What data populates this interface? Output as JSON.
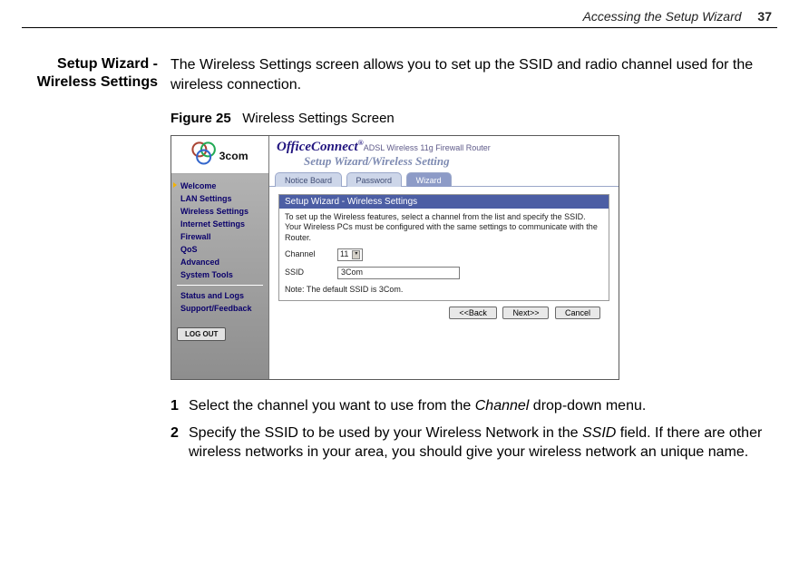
{
  "page_header": {
    "title": "Accessing the Setup Wizard",
    "number": "37"
  },
  "section_heading_line1": "Setup Wizard -",
  "section_heading_line2": "Wireless Settings",
  "intro": "The Wireless Settings screen allows you to set up the SSID and radio channel used for the wireless connection.",
  "figure": {
    "label": "Figure 25",
    "caption": "Wireless Settings Screen"
  },
  "screenshot": {
    "brand_main": "OfficeConnect",
    "brand_reg": "®",
    "brand_tag": "ADSL Wireless 11g Firewall Router",
    "subheading": "Setup Wizard/Wireless Setting",
    "tabs": [
      "Notice Board",
      "Password",
      "Wizard"
    ],
    "active_tab_index": 2,
    "sidebar": {
      "items": [
        "Welcome",
        "LAN Settings",
        "Wireless Settings",
        "Internet Settings",
        "Firewall",
        "QoS",
        "Advanced",
        "System Tools"
      ],
      "items2": [
        "Status and Logs",
        "Support/Feedback"
      ],
      "active_index": 0,
      "logout": "LOG OUT"
    },
    "panel": {
      "title": "Setup Wizard - Wireless Settings",
      "description": "To set up the Wireless features, select a channel from the list and specify the SSID. Your Wireless PCs must be configured with the same settings to communicate with the Router.",
      "channel_label": "Channel",
      "channel_value": "11",
      "ssid_label": "SSID",
      "ssid_value": "3Com",
      "note": "Note: The default SSID is 3Com.",
      "back_btn": "<<Back",
      "next_btn": "Next>>",
      "cancel_btn": "Cancel"
    }
  },
  "steps": [
    {
      "n": "1",
      "before": "Select the channel you want to use from the ",
      "em": "Channel",
      "after": " drop-down menu."
    },
    {
      "n": "2",
      "before": "Specify the SSID to be used by your Wireless Network in the ",
      "em": "SSID",
      "after": " field. If there are other wireless networks in your area, you should give your wireless network an unique name."
    }
  ]
}
